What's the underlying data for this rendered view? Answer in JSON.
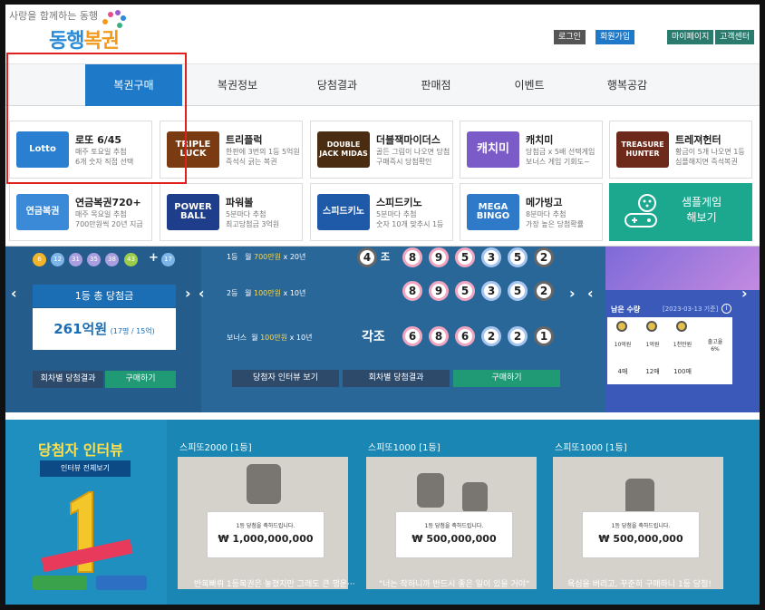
{
  "header": {
    "slogan": "사랑을 함께하는 동행",
    "logo_part1": "동행",
    "logo_part2": "복권",
    "util_links": [
      {
        "label": "로그인",
        "color": "#555555"
      },
      {
        "label": "회원가입",
        "color": "#1f79c9"
      },
      {
        "label": "마이페이지",
        "color": "#2a7a6e"
      },
      {
        "label": "고객센터",
        "color": "#2a7a6e"
      }
    ]
  },
  "nav": {
    "items": [
      "복권구매",
      "복권정보",
      "당첨결과",
      "판매점",
      "이벤트",
      "행복공감"
    ],
    "active_index": 0
  },
  "dropdown": {
    "games": [
      {
        "name": "로또 6/45",
        "desc1": "매주 토요일 추첨",
        "desc2": "6개 숫자 직접 선택",
        "thumb": "Lotto",
        "thumb_color": "#2a7fd0"
      },
      {
        "name": "트리플럭",
        "desc1": "한판에 3번의 1등 5억원",
        "desc2": "즉석식 긁는 복권",
        "thumb": "TRIPLE LUCK",
        "thumb_color": "#7a3a12"
      },
      {
        "name": "더블잭마이더스",
        "desc1": "골든 그림이 나오면 당첨",
        "desc2": "구매즉시 당첨확인",
        "thumb": "DOUBLE JACK MIDAS",
        "thumb_color": "#4a2c10"
      },
      {
        "name": "캐치미",
        "desc1": "당첨금 x 5배 선택게임",
        "desc2": "보너스 게임 기회도~",
        "thumb": "캐치미",
        "thumb_color": "#7b5bc8"
      },
      {
        "name": "트레져헌터",
        "desc1": "황금이 5개 나오면 1등",
        "desc2": "심플해지면 즉석복권",
        "thumb": "TREASURE HUNTER",
        "thumb_color": "#6d2a1a"
      },
      {
        "name": "연금복권720+",
        "desc1": "매주 목요일 추첨",
        "desc2": "700만원씩 20년 지급",
        "thumb": "연금복권",
        "thumb_color": "#3a8ad8"
      },
      {
        "name": "파워볼",
        "desc1": "5분마다 추첨",
        "desc2": "최고당첨금 3억원",
        "thumb": "POWER BALL",
        "thumb_color": "#1e3d8a"
      },
      {
        "name": "스피드키노",
        "desc1": "5분마다 추첨",
        "desc2": "숫자 10개 맞추시 1등",
        "thumb": "스피드키노",
        "thumb_color": "#1f5aa8"
      },
      {
        "name": "메가빙고",
        "desc1": "8분마다 추첨",
        "desc2": "가장 높은 당첨확률",
        "thumb": "MEGA BINGO",
        "thumb_color": "#2e79c8"
      }
    ],
    "sample": {
      "line1": "샘플게임",
      "line2": "해보기"
    }
  },
  "results_left": {
    "mini_balls": [
      {
        "n": "6",
        "color": "#f2b52a"
      },
      {
        "n": "12",
        "color": "#7db5e8"
      },
      {
        "n": "31",
        "color": "#a89ee0"
      },
      {
        "n": "35",
        "color": "#a89ee0"
      },
      {
        "n": "38",
        "color": "#a89ee0"
      },
      {
        "n": "43",
        "color": "#9ccd4a"
      }
    ],
    "plus": "+",
    "bonus_ball": {
      "n": "17",
      "color": "#7db5e8"
    },
    "first_prize_title": "1등 총 당첨금",
    "first_prize_amount": "261억원",
    "first_prize_sub": "(17명 / 15억)",
    "btn_round": "회차별 당첨결과",
    "btn_buy": "구매하기"
  },
  "results_mid": {
    "rows": [
      {
        "label_pre": "1등",
        "label_amt": "700만원",
        "label_post": " x 20년",
        "prefix": "4",
        "prefix_suffix": "조",
        "balls": [
          "8",
          "9",
          "5",
          "3",
          "5",
          "2"
        ]
      },
      {
        "label_pre": "2등",
        "label_amt": "100만원",
        "label_post": " x 10년",
        "prefix": "",
        "prefix_suffix": "",
        "balls": [
          "8",
          "9",
          "5",
          "3",
          "5",
          "2"
        ]
      },
      {
        "label_pre": "보너스",
        "label_amt": "100만원",
        "label_post": " x 10년",
        "prefix": "각조",
        "prefix_suffix": "",
        "balls": [
          "6",
          "8",
          "6",
          "2",
          "2",
          "1"
        ]
      }
    ],
    "month_prefix": "월 ",
    "btn_interview": "당첨자 인터뷰 보기",
    "btn_round": "회차별 당첨결과",
    "btn_buy": "구매하기"
  },
  "results_right": {
    "remain_title": "남은 수량",
    "remain_date": "[2023-03-13 기준]",
    "info_icon": "i",
    "medals": [
      {
        "label": "10억원",
        "count": "4매"
      },
      {
        "label": "1억원",
        "count": "12매"
      },
      {
        "label": "1천만원",
        "count": "100매"
      },
      {
        "label": "출고율",
        "count": "6%"
      }
    ]
  },
  "interview": {
    "title": "당첨자 인터뷰",
    "btn_all": "인터뷰 전체보기",
    "cards": [
      {
        "title": "스피또2000 [1등]",
        "board_line": "1등 당첨을 축하드립니다.",
        "amount": "₩ 1,000,000,000",
        "caption": "반복빠뤼 1등복권은 놓쳤지만 그래도 큰 행운···"
      },
      {
        "title": "스피또1000 [1등]",
        "board_line": "1등 당첨을 축하드립니다.",
        "amount": "₩ 500,000,000",
        "caption": "\"너는 착하니까 반드시 좋은 일이 있을 거야\""
      },
      {
        "title": "스피또1000 [1등]",
        "board_line": "1등 당첨을 축하드립니다.",
        "amount": "₩ 500,000,000",
        "caption": "욕심을 버리고, 꾸준히 구매하니 1등 당첨!"
      }
    ]
  },
  "colors": {
    "highlight": "#e0201e",
    "accent": "#1f79c9",
    "green": "#1f9a74"
  }
}
